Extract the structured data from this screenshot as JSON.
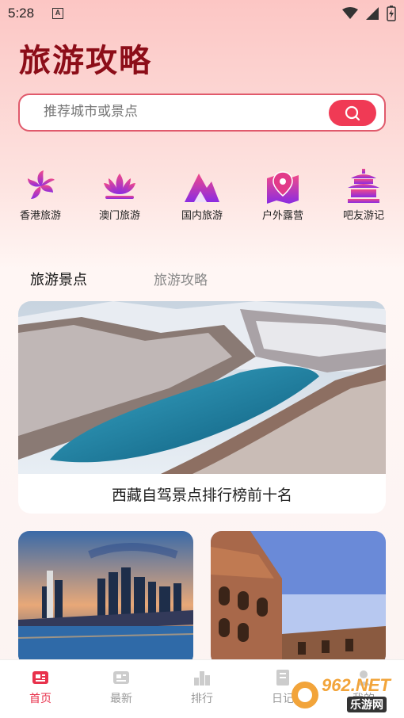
{
  "status_bar": {
    "time": "5:28",
    "notification_badge": "A"
  },
  "app": {
    "title": "旅游攻略"
  },
  "search": {
    "placeholder": "推荐城市或景点"
  },
  "categories": [
    {
      "label": "香港旅游",
      "icon": "bauhinia-icon"
    },
    {
      "label": "澳门旅游",
      "icon": "lotus-icon"
    },
    {
      "label": "国内旅游",
      "icon": "mountain-icon"
    },
    {
      "label": "户外露营",
      "icon": "map-pin-icon"
    },
    {
      "label": "吧友游记",
      "icon": "temple-icon"
    }
  ],
  "tabs": [
    {
      "label": "旅游景点",
      "active": true
    },
    {
      "label": "旅游攻略",
      "active": false
    }
  ],
  "featured": {
    "caption": "西藏自驾景点排行榜前十名"
  },
  "bottom_nav": [
    {
      "label": "首页",
      "active": true
    },
    {
      "label": "最新",
      "active": false
    },
    {
      "label": "排行",
      "active": false
    },
    {
      "label": "日记",
      "active": false
    },
    {
      "label": "我的",
      "active": false
    }
  ],
  "watermark": {
    "brand": "962.NET",
    "sub": "乐游网"
  },
  "colors": {
    "accent": "#f03a55",
    "title": "#8c0d18",
    "icon_gradient_top": "#f04a8a",
    "icon_gradient_bottom": "#8a2be2"
  }
}
